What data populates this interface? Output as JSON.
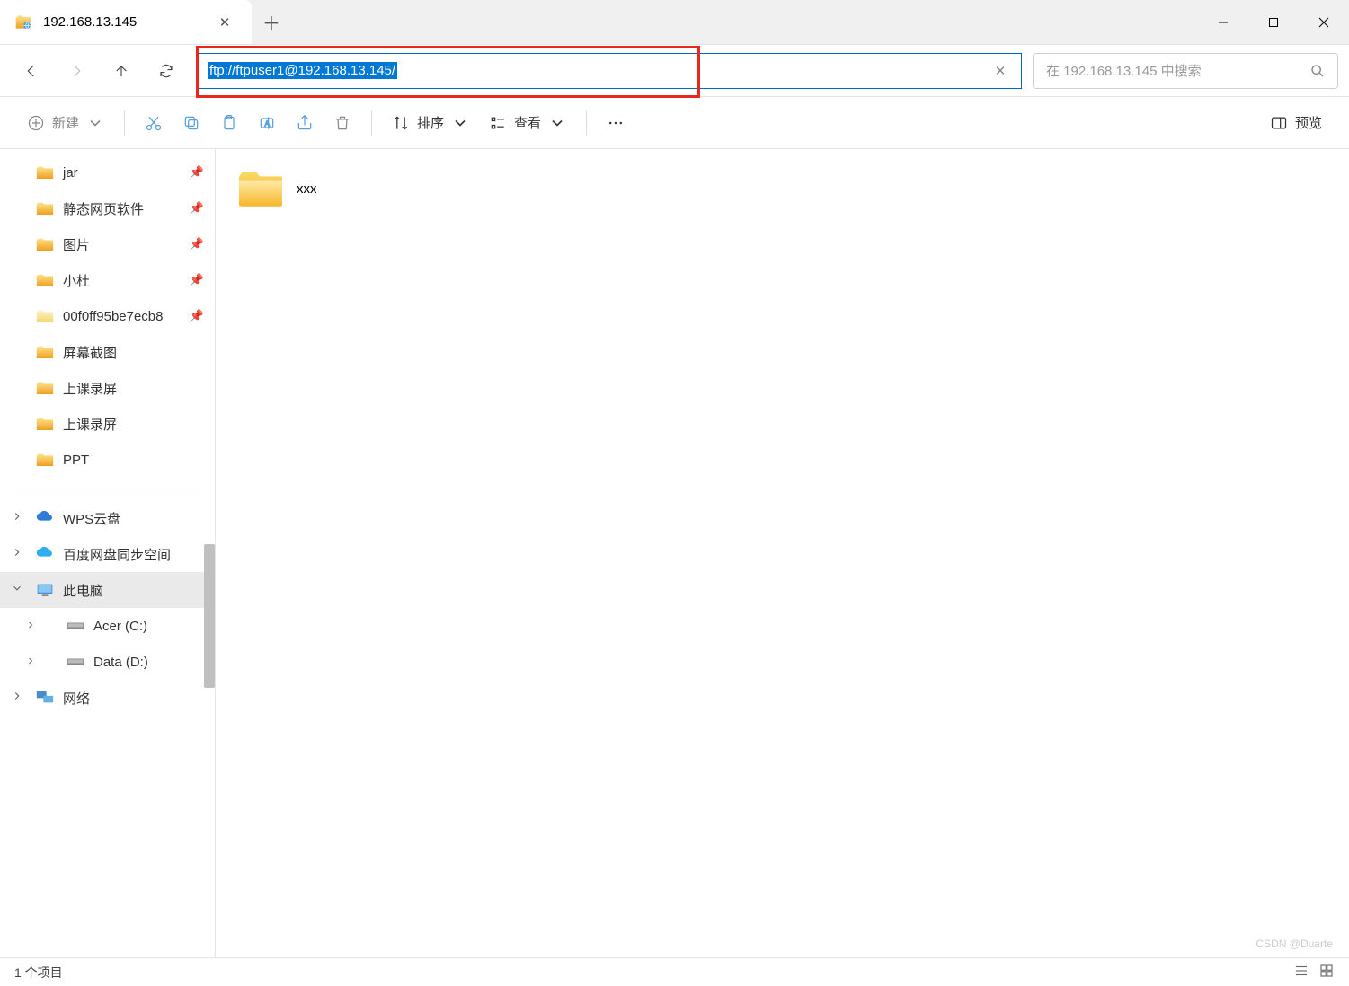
{
  "tab": {
    "title": "192.168.13.145"
  },
  "address": {
    "value": "ftp://ftpuser1@192.168.13.145/"
  },
  "search": {
    "placeholder": "在 192.168.13.145 中搜索"
  },
  "toolbar": {
    "new": "新建",
    "sort": "排序",
    "view": "查看",
    "preview": "预览"
  },
  "sidebar": {
    "quick": [
      {
        "label": "jar",
        "pinned": true
      },
      {
        "label": "静态网页软件",
        "pinned": true
      },
      {
        "label": "图片",
        "pinned": true
      },
      {
        "label": "小杜",
        "pinned": true
      },
      {
        "label": "00f0ff95be7ecb8",
        "pinned": true,
        "light": true
      },
      {
        "label": "屏幕截图",
        "pinned": false
      },
      {
        "label": "上课录屏",
        "pinned": false
      },
      {
        "label": "上课录屏",
        "pinned": false
      },
      {
        "label": "PPT",
        "pinned": false
      }
    ],
    "cloud": [
      {
        "label": "WPS云盘",
        "icon": "wps"
      },
      {
        "label": "百度网盘同步空间",
        "icon": "baidu"
      }
    ],
    "pc": {
      "label": "此电脑"
    },
    "drives": [
      {
        "label": "Acer (C:)"
      },
      {
        "label": "Data (D:)"
      }
    ],
    "network": {
      "label": "网络"
    }
  },
  "content": {
    "items": [
      {
        "name": "xxx",
        "type": "folder"
      }
    ]
  },
  "status": {
    "text": "1 个项目"
  },
  "watermark": "CSDN @Duarte"
}
